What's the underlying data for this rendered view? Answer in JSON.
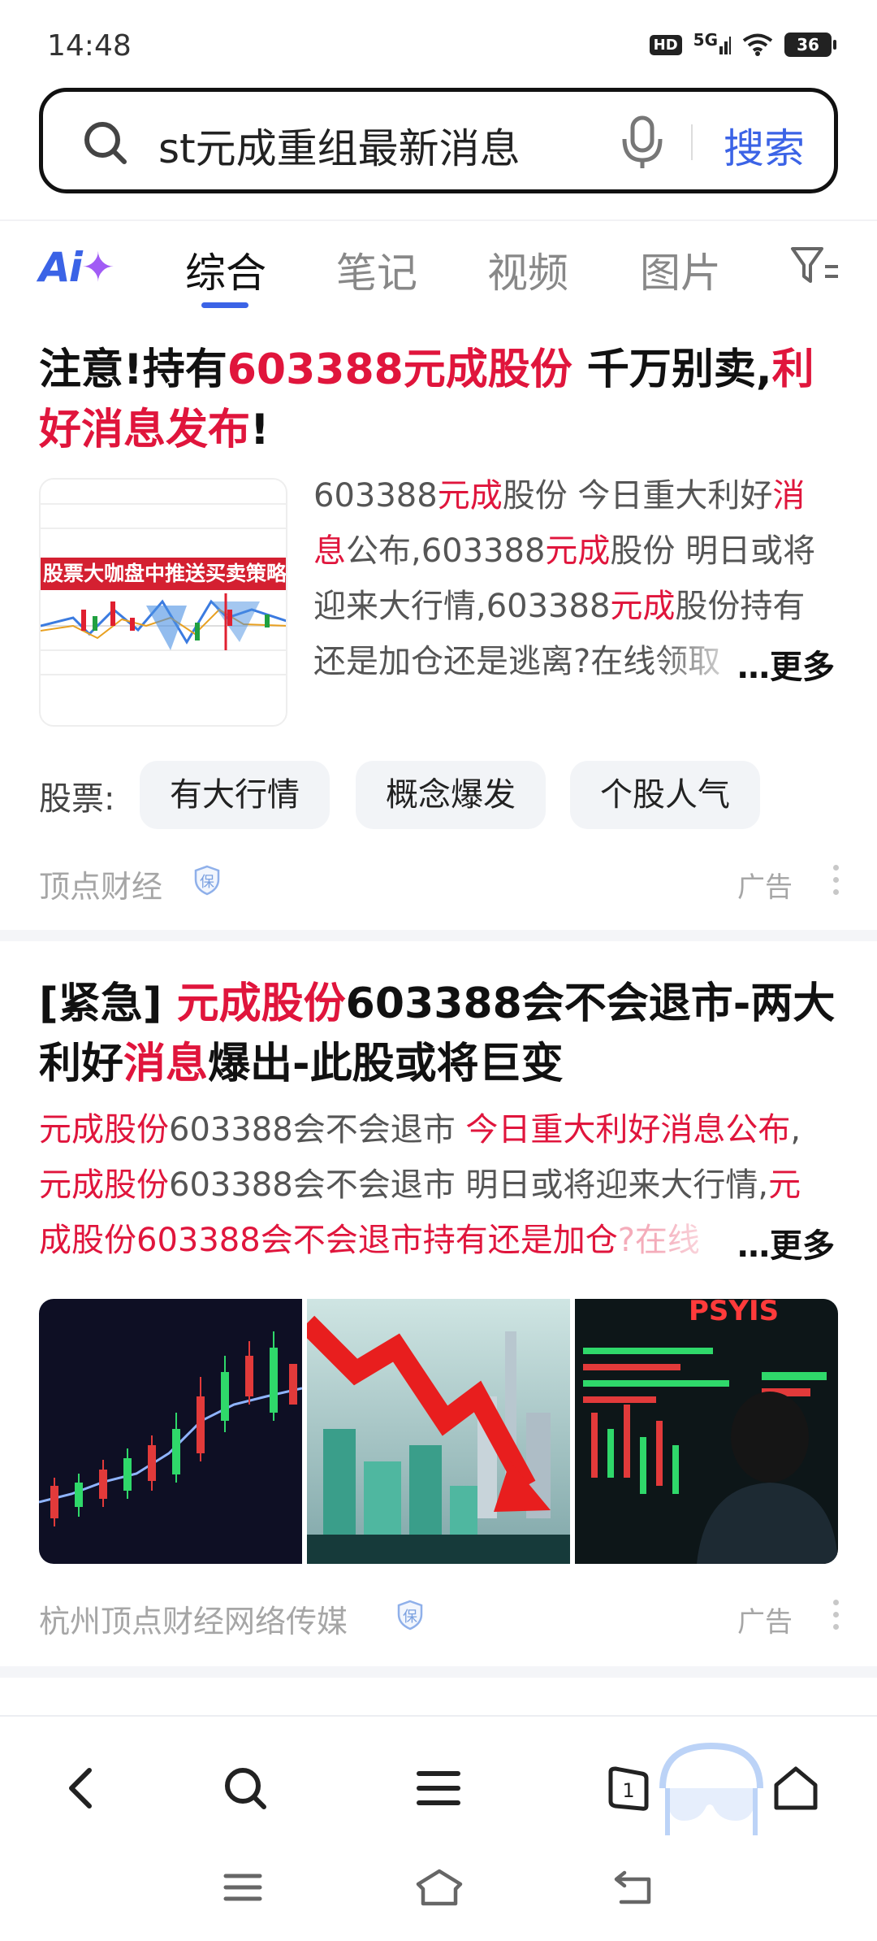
{
  "status_bar": {
    "time": "14:48",
    "hd": "HD",
    "network": "5G",
    "battery": "36"
  },
  "search": {
    "query": "st元成重组最新消息",
    "button_label": "搜索"
  },
  "tabs": {
    "ai_logo": "Ai",
    "items": [
      "综合",
      "笔记",
      "视频",
      "图片"
    ]
  },
  "result1": {
    "title_parts": [
      "注意!持有",
      "603388元成股份",
      " 千万别卖,",
      "利好消息发布",
      "!"
    ],
    "snippet_lines": [
      [
        "603388",
        "元成",
        "股份 今日重大利好",
        "消"
      ],
      [
        "息",
        "公布,603388",
        "元成",
        "股份 明日或将"
      ],
      [
        "迎来大行情,603388",
        "元成",
        "股份持有"
      ],
      [
        "还是加仓还是逃离?在线领取"
      ]
    ],
    "more_label": "…更多",
    "thumbnail_banner": "股票大咖盘中推送买卖策略",
    "tags_label": "股票:",
    "tags": [
      "有大行情",
      "概念爆发",
      "个股人气"
    ],
    "source": "顶点财经",
    "badge": "保",
    "ad_label": "广告"
  },
  "result2": {
    "title_parts": [
      "[紧急] ",
      "元成股份",
      "603388会不会退市-两大",
      "利好",
      "消息",
      "爆出-此股或将巨变"
    ],
    "snippet_lines": [
      [
        "元成股份",
        "603388会不会退市 ",
        "今日重大利好消息公布",
        ","
      ],
      [
        "元成股份",
        "603388会不会退市 明日或将迎来大行情,",
        "元"
      ],
      [
        "成股份603388会不会退市持有还是加仓",
        "?在线"
      ]
    ],
    "more_label": "…更多",
    "source": "杭州顶点财经网络传媒",
    "badge": "保",
    "ad_label": "广告"
  },
  "bottom_nav": {
    "tabs_count": "1"
  },
  "colors": {
    "accent": "#3b63e6",
    "highlight": "#e0153c",
    "ai_plus": "#a15cf5"
  },
  "icons": [
    "search-icon",
    "mic-icon",
    "filter-icon",
    "shield-icon",
    "more-vert-icon",
    "back-icon",
    "search-nav-icon",
    "menu-icon",
    "tabs-icon",
    "home-icon",
    "sys-menu-icon",
    "sys-home-icon",
    "sys-back-icon"
  ]
}
